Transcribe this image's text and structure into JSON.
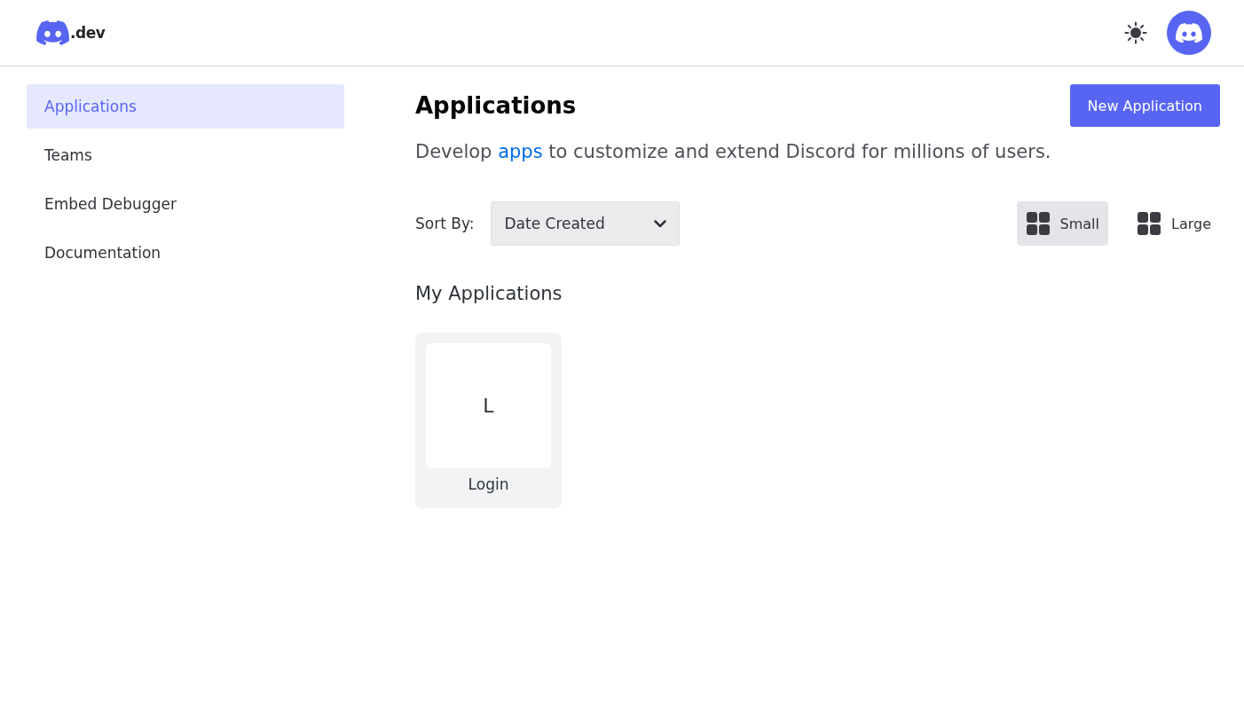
{
  "header": {
    "logo_text": ".dev"
  },
  "sidebar": {
    "items": [
      {
        "label": "Applications",
        "selected": true
      },
      {
        "label": "Teams",
        "selected": false
      },
      {
        "label": "Embed Debugger",
        "selected": false
      },
      {
        "label": "Documentation",
        "selected": false
      }
    ]
  },
  "main": {
    "title": "Applications",
    "new_button": "New Application",
    "description": {
      "before": "Develop ",
      "link": "apps",
      "after": " to customize and extend Discord for millions of users."
    },
    "sort": {
      "label": "Sort By:",
      "value": "Date Created"
    },
    "views": [
      {
        "label": "Small",
        "selected": true
      },
      {
        "label": "Large",
        "selected": false
      }
    ],
    "section_title": "My Applications",
    "apps": [
      {
        "initial": "L",
        "name": "Login"
      }
    ]
  }
}
